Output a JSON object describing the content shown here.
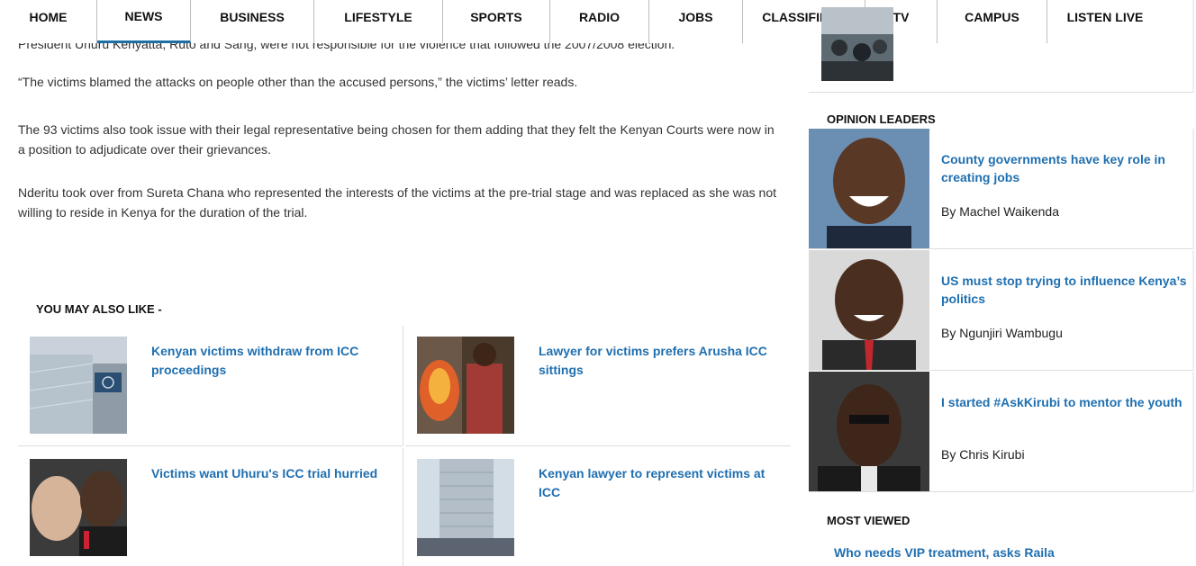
{
  "nav": {
    "items": [
      {
        "label": "HOME",
        "active": false
      },
      {
        "label": "NEWS",
        "active": true
      },
      {
        "label": "BUSINESS",
        "active": false
      },
      {
        "label": "LIFESTYLE",
        "active": false
      },
      {
        "label": "SPORTS",
        "active": false
      },
      {
        "label": "RADIO",
        "active": false
      },
      {
        "label": "JOBS",
        "active": false
      },
      {
        "label": "CLASSIFIEDS",
        "active": false
      },
      {
        "label": "TV",
        "active": false
      },
      {
        "label": "CAMPUS",
        "active": false
      },
      {
        "label": "LISTEN LIVE",
        "active": false
      }
    ]
  },
  "article": {
    "cut_off_line": "President Uhuru Kenyatta, Ruto and Sang, were not responsible for the violence that followed the 2007/2008 election.",
    "paragraphs": [
      "“The victims blamed the attacks on people other than the accused persons,” the victims’ letter reads.",
      "The 93 victims also took issue with their legal representative being chosen for them adding that they felt the Kenyan Courts were now in a position to adjudicate over their grievances.",
      "Nderitu took over from Sureta Chana who represented the interests of the victims at the pre-trial stage and was replaced as she was not willing to reside in Kenya for the duration of the trial."
    ]
  },
  "related": {
    "title": "YOU MAY ALSO LIKE -",
    "items": [
      {
        "title": "Kenyan victims withdraw from ICC proceedings",
        "image": "icc-building-flag"
      },
      {
        "title": "Lawyer for victims prefers Arusha ICC sittings",
        "image": "violence-fire-scene"
      },
      {
        "title": "Victims want Uhuru's ICC trial hurried",
        "image": "courtroom-faces"
      },
      {
        "title": "Kenyan lawyer to represent victims at ICC",
        "image": "icc-tower-building"
      }
    ]
  },
  "sidebar": {
    "opinion_title": "OPINION LEADERS",
    "opinions": [
      {
        "title": "County governments have key role in creating jobs",
        "byline": "By Machel Waikenda",
        "image": "smiling-man-portrait"
      },
      {
        "title": "US must stop trying to influence Kenya’s politics",
        "byline": "By Ngunjiri Wambugu",
        "image": "man-red-tie-portrait"
      },
      {
        "title": "I started #AskKirubi to mentor the youth",
        "byline": "By Chris Kirubi",
        "image": "older-man-portrait"
      }
    ],
    "most_viewed_title": "MOST VIEWED",
    "most_viewed": [
      {
        "title": "Who needs VIP treatment, asks Raila"
      }
    ]
  },
  "colors": {
    "link": "#1f6fb0",
    "nav_active": "#1d6fa5"
  }
}
